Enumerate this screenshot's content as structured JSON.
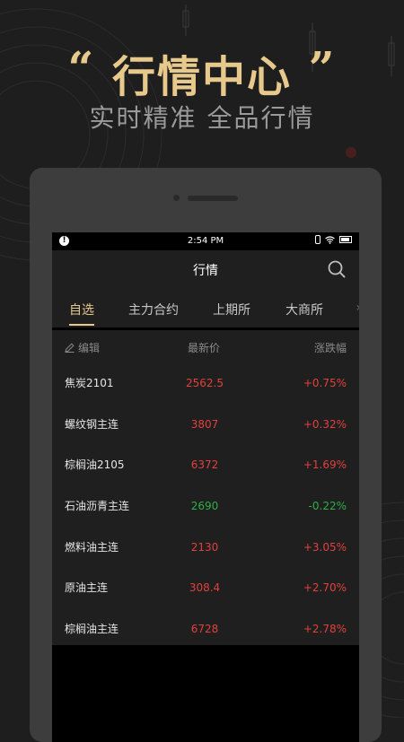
{
  "promo": {
    "headline": "行情中心",
    "open_quote": "“",
    "close_quote": "”",
    "subtitle": "实时精准 全品行情"
  },
  "colors": {
    "accent": "#e8c98c",
    "up": "#e2403b",
    "down": "#2fae46",
    "background": "#1e1e1f"
  },
  "status_bar": {
    "time": "2:54 PM",
    "alert_icon": "alert-icon",
    "vibrate_icon": "vibrate-icon",
    "wifi_icon": "wifi-icon",
    "battery_icon": "battery-icon"
  },
  "header": {
    "title": "行情",
    "search_icon": "search-icon"
  },
  "tabs": [
    {
      "label": "自选",
      "active": true
    },
    {
      "label": "主力合约",
      "active": false
    },
    {
      "label": "上期所",
      "active": false
    },
    {
      "label": "大商所",
      "active": false
    }
  ],
  "columns": {
    "edit": "编辑",
    "price": "最新价",
    "change": "涨跌幅"
  },
  "rows": [
    {
      "name": "焦炭2101",
      "price": "2562.5",
      "change": "+0.75%",
      "trend": "up"
    },
    {
      "name": "螺纹钢主连",
      "price": "3807",
      "change": "+0.32%",
      "trend": "up"
    },
    {
      "name": "棕榈油2105",
      "price": "6372",
      "change": "+1.69%",
      "trend": "up"
    },
    {
      "name": "石油沥青主连",
      "price": "2690",
      "change": "-0.22%",
      "trend": "down"
    },
    {
      "name": "燃料油主连",
      "price": "2130",
      "change": "+3.05%",
      "trend": "up"
    },
    {
      "name": "原油主连",
      "price": "308.4",
      "change": "+2.70%",
      "trend": "up"
    },
    {
      "name": "棕榈油主连",
      "price": "6728",
      "change": "+2.78%",
      "trend": "up"
    }
  ]
}
